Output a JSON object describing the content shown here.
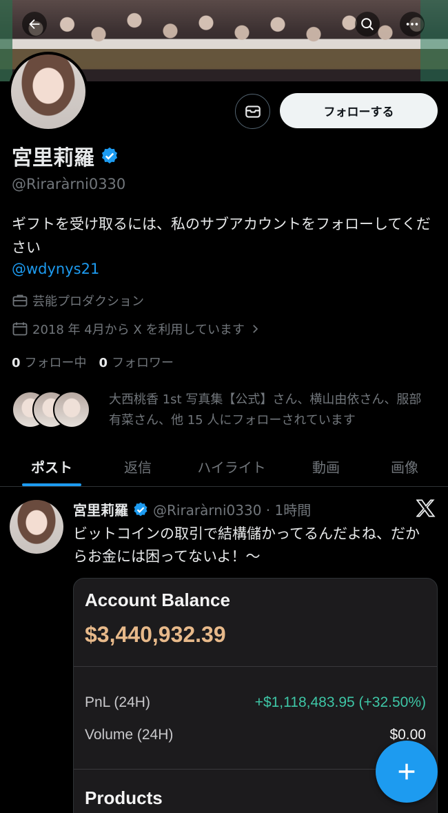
{
  "profile": {
    "name": "宮里莉羅",
    "handle": "@Riraràrni0330",
    "follow_label": "フォローする",
    "bio": "ギフトを受け取るには、私のサブアカウントをフォローしてください",
    "bio_link": "@wdynys21",
    "category": "芸能プロダクション",
    "joined": "2018 年 4月から X を利用しています",
    "following_count": "0",
    "following_label": "フォロー中",
    "followers_count": "0",
    "followers_label": "フォロワー",
    "mutuals_text": "大西桃香 1st 写真集【公式】さん、横山由依さん、服部 有菜さん、他 15 人にフォローされています"
  },
  "tabs": [
    {
      "label": "ポスト"
    },
    {
      "label": "返信"
    },
    {
      "label": "ハイライト"
    },
    {
      "label": "動画"
    },
    {
      "label": "画像"
    }
  ],
  "post": {
    "author": "宮里莉羅",
    "handle_time": "@Riraràrni0330 · 1時間",
    "text": "ビットコインの取引で結構儲かってるんだよね、だからお金には困ってないよ！〜",
    "card": {
      "title": "Account Balance",
      "balance": "$3,440,932.39",
      "pnl_label": "PnL (24H)",
      "pnl_value": "+$1,118,483.95 (+32.50%)",
      "volume_label": "Volume (24H)",
      "volume_value": "$0.00",
      "products_label": "Products"
    }
  },
  "icons": [
    "back-arrow-icon",
    "search-icon",
    "more-icon",
    "mail-icon",
    "verified-icon",
    "briefcase-icon",
    "calendar-icon",
    "chevron-right-icon",
    "x-logo-icon",
    "plus-icon"
  ],
  "colors": {
    "accent": "#1d9bf0",
    "balance": "#e7b98a",
    "gain": "#3ec6a6"
  }
}
